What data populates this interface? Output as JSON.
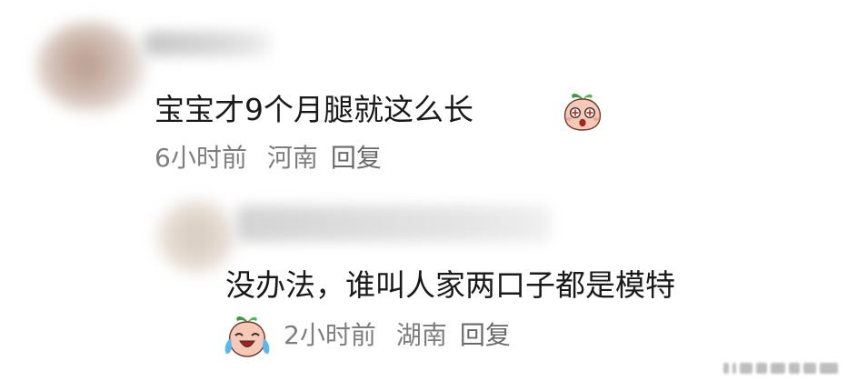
{
  "comments": [
    {
      "text": "宝宝才9个月腿就这么长",
      "emoji": "surprised-radish-emoji",
      "time": "6小时前",
      "region": "河南",
      "reply_label": "回复"
    },
    {
      "text": "没办法，谁叫人家两口子都是模特",
      "emoji": "laugh-cry-radish-emoji",
      "time": "2小时前",
      "region": "湖南",
      "reply_label": "回复"
    }
  ],
  "colors": {
    "text": "#1a1a1a",
    "meta": "#7e7e7e",
    "background": "#ffffff"
  }
}
